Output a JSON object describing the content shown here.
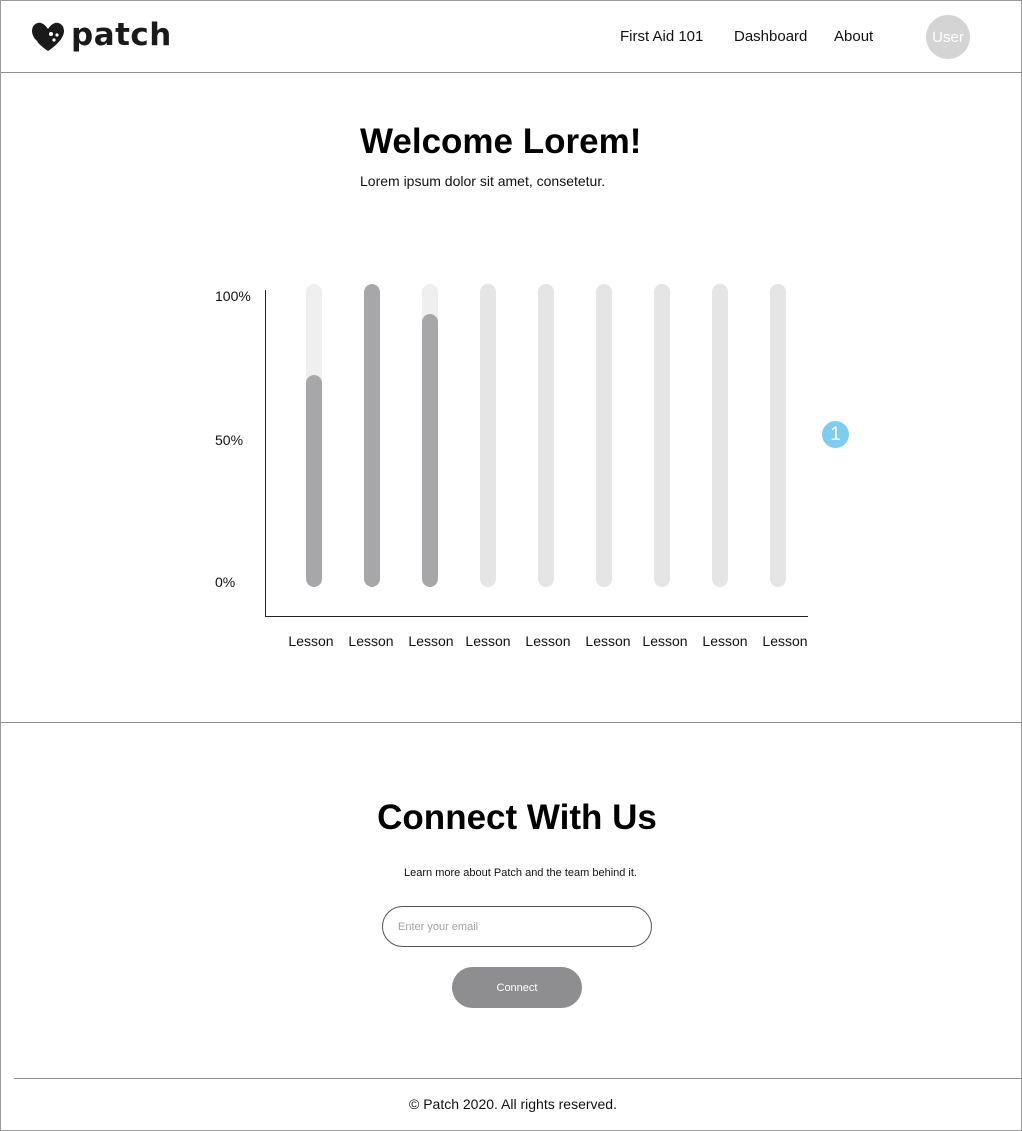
{
  "header": {
    "logo_text": "patch",
    "nav": [
      "First Aid 101",
      "Dashboard",
      "About"
    ],
    "user_label": "User"
  },
  "welcome": {
    "title": "Welcome Lorem!",
    "subtitle": "Lorem ipsum dolor sit amet, consetetur."
  },
  "chart_data": {
    "type": "bar",
    "categories": [
      "Lesson",
      "Lesson",
      "Lesson",
      "Lesson",
      "Lesson",
      "Lesson",
      "Lesson",
      "Lesson",
      "Lesson"
    ],
    "values": [
      70,
      100,
      90,
      0,
      0,
      0,
      0,
      0,
      0
    ],
    "y_ticks": [
      "100%",
      "50%",
      "0%"
    ],
    "ylim": [
      0,
      100
    ],
    "fill_color": "#a7a7a9",
    "track_colors": [
      "#efefef",
      "#efefef",
      "#efefef",
      "#e5e5e6",
      "#e5e5e6",
      "#e5e5e6",
      "#e5e5e6",
      "#e5e5e6",
      "#e5e5e6"
    ]
  },
  "marker": {
    "label": "1",
    "color": "#7dcdf2"
  },
  "connect": {
    "title": "Connect With Us",
    "subtitle": "Learn more about Patch and the team behind it.",
    "email_placeholder": "Enter your email",
    "button_label": "Connect"
  },
  "footer": {
    "text": "© Patch 2020. All rights reserved."
  }
}
